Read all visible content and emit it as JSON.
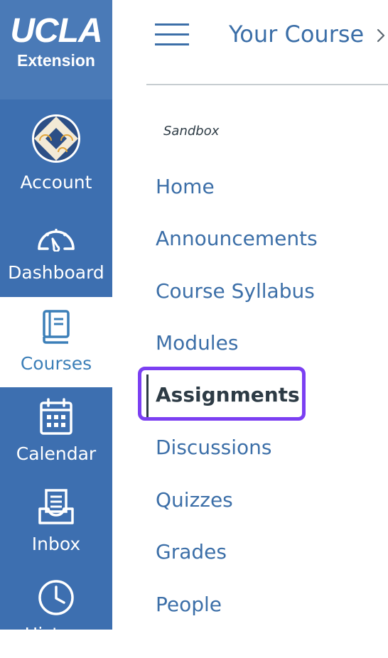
{
  "global_nav": {
    "logo": {
      "line1": "UCLA",
      "line2": "Extension"
    },
    "items": [
      {
        "label": "Account",
        "icon": "account-avatar-icon",
        "active": false
      },
      {
        "label": "Dashboard",
        "icon": "dashboard-gauge-icon",
        "active": false
      },
      {
        "label": "Courses",
        "icon": "book-icon",
        "active": true
      },
      {
        "label": "Calendar",
        "icon": "calendar-icon",
        "active": false
      },
      {
        "label": "Inbox",
        "icon": "inbox-icon",
        "active": false
      },
      {
        "label": "History",
        "icon": "clock-icon",
        "active": false
      }
    ]
  },
  "header": {
    "menu_icon": "hamburger-icon",
    "title": "Your Course",
    "chevron_icon": "chevron-right-icon"
  },
  "course_nav": {
    "term": "Sandbox",
    "links": [
      {
        "label": "Home",
        "active": false
      },
      {
        "label": "Announcements",
        "active": false
      },
      {
        "label": "Course Syllabus",
        "active": false
      },
      {
        "label": "Modules",
        "active": false
      },
      {
        "label": "Assignments",
        "active": true
      },
      {
        "label": "Discussions",
        "active": false
      },
      {
        "label": "Quizzes",
        "active": false
      },
      {
        "label": "Grades",
        "active": false
      },
      {
        "label": "People",
        "active": false
      }
    ]
  },
  "colors": {
    "global_nav_bg": "#3d6fb0",
    "link": "#3c6fa8",
    "active_text": "#2d3b45",
    "highlight": "#7b3ff2"
  }
}
